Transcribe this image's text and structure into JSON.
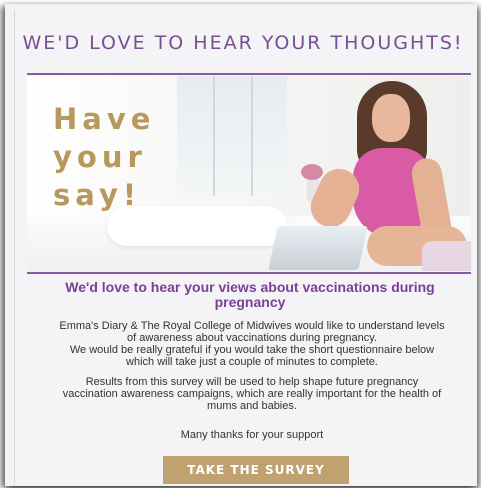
{
  "header": {
    "title": "WE'D LOVE TO HEAR YOUR THOUGHTS!"
  },
  "hero": {
    "tagline_lines": [
      "Have",
      "your",
      "say!"
    ],
    "image": "woman-with-laptop-photo"
  },
  "content": {
    "subheading": "We'd love to hear your views about vaccinations during pregnancy",
    "paragraph_1_lines": [
      "Emma's Diary & The Royal College of Midwives would like to understand levels",
      "of awareness about vaccinations during pregnancy.",
      "We would be really grateful if you would take the short questionnaire below",
      "which will take just a couple of minutes to complete."
    ],
    "paragraph_2_lines": [
      "Results from this survey will be used to help shape future pregnancy",
      "vaccination awareness campaigns, which are really important for the health of",
      "mums and babies."
    ],
    "closing": "Many thanks for your support"
  },
  "cta": {
    "label": "TAKE THE SURVEY"
  },
  "colors": {
    "purple": "#7b3f98",
    "gold": "#c0a271",
    "background": "#f4f3f5"
  }
}
